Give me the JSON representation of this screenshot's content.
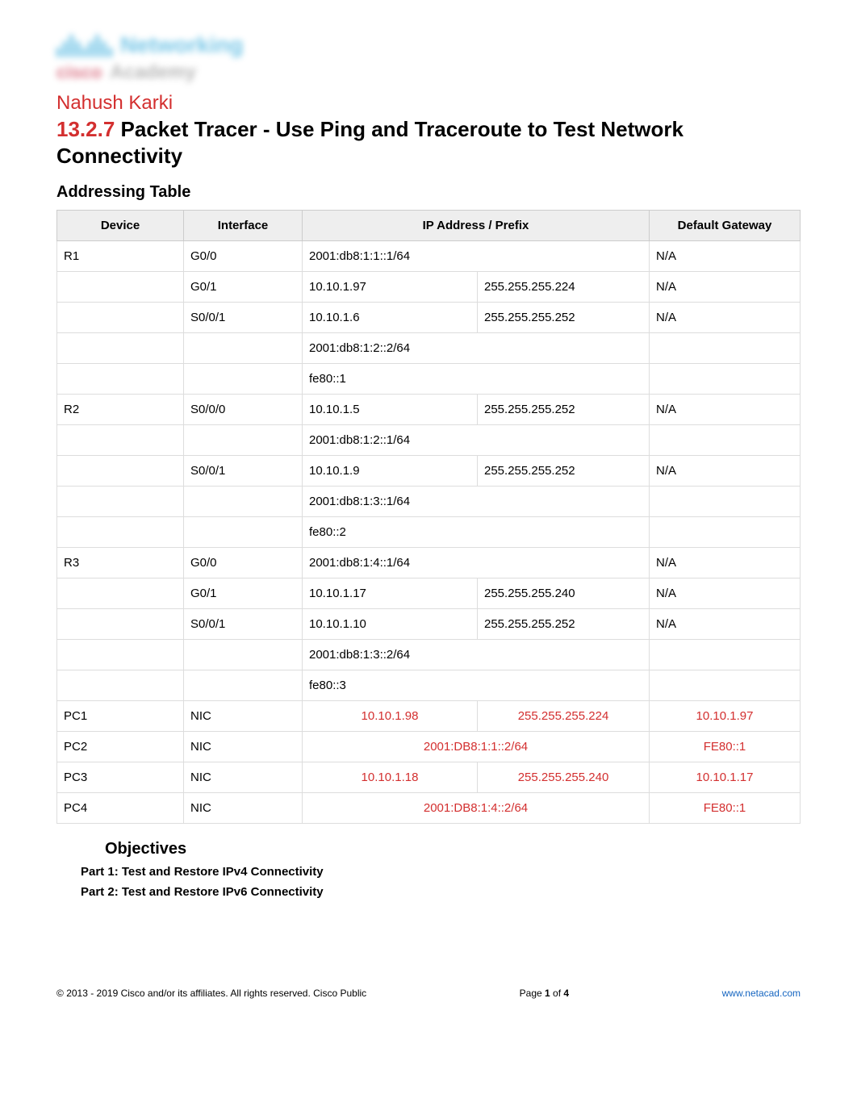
{
  "logo": {
    "line1": "Networking",
    "cisco": "cisco",
    "line2": "Academy"
  },
  "author": "Nahush Karki",
  "title_num": "13.2.7",
  "title_rest": " Packet Tracer - Use Ping and Traceroute to Test Network Connectivity",
  "addressing_heading": "Addressing Table",
  "table": {
    "headers": {
      "device": "Device",
      "interface": "Interface",
      "ipprefix": "IP Address / Prefix",
      "gateway": "Default Gateway"
    },
    "rows": [
      {
        "device": "R1",
        "iface": "G0/0",
        "ip1": "2001:db8:1:1::1/64",
        "ip2": "",
        "gw": "N/A",
        "colspan_ip": true
      },
      {
        "device": "",
        "iface": "G0/1",
        "ip1": "10.10.1.97",
        "ip2": "255.255.255.224",
        "gw": "N/A"
      },
      {
        "device": "",
        "iface": "S0/0/1",
        "ip1": "10.10.1.6",
        "ip2": "255.255.255.252",
        "gw": "N/A"
      },
      {
        "device": "",
        "iface": "",
        "ip1": "2001:db8:1:2::2/64",
        "ip2": "",
        "gw": "",
        "colspan_ip": true
      },
      {
        "device": "",
        "iface": "",
        "ip1": "fe80::1",
        "ip2": "",
        "gw": "",
        "colspan_ip": true
      },
      {
        "device": "R2",
        "iface": "S0/0/0",
        "ip1": "10.10.1.5",
        "ip2": "255.255.255.252",
        "gw": "N/A"
      },
      {
        "device": "",
        "iface": "",
        "ip1": "2001:db8:1:2::1/64",
        "ip2": "",
        "gw": "",
        "colspan_ip": true
      },
      {
        "device": "",
        "iface": "S0/0/1",
        "ip1": "10.10.1.9",
        "ip2": "255.255.255.252",
        "gw": "N/A"
      },
      {
        "device": "",
        "iface": "",
        "ip1": "2001:db8:1:3::1/64",
        "ip2": "",
        "gw": "",
        "colspan_ip": true
      },
      {
        "device": "",
        "iface": "",
        "ip1": "fe80::2",
        "ip2": "",
        "gw": "",
        "colspan_ip": true
      },
      {
        "device": "R3",
        "iface": "G0/0",
        "ip1": "2001:db8:1:4::1/64",
        "ip2": "",
        "gw": "N/A",
        "colspan_ip": true
      },
      {
        "device": "",
        "iface": "G0/1",
        "ip1": "10.10.1.17",
        "ip2": "255.255.255.240",
        "gw": "N/A"
      },
      {
        "device": "",
        "iface": "S0/0/1",
        "ip1": "10.10.1.10",
        "ip2": "255.255.255.252",
        "gw": "N/A"
      },
      {
        "device": "",
        "iface": "",
        "ip1": "2001:db8:1:3::2/64",
        "ip2": "",
        "gw": "",
        "colspan_ip": true
      },
      {
        "device": "",
        "iface": "",
        "ip1": "fe80::3",
        "ip2": "",
        "gw": "",
        "colspan_ip": true
      },
      {
        "device": "PC1",
        "iface": "NIC",
        "ip1": "10.10.1.98",
        "ip2": "255.255.255.224",
        "gw": "10.10.1.97",
        "red": true
      },
      {
        "device": "PC2",
        "iface": "NIC",
        "ip1": "2001:DB8:1:1::2/64",
        "ip2": "",
        "gw": "FE80::1",
        "red": true,
        "colspan_ip": true
      },
      {
        "device": "PC3",
        "iface": "NIC",
        "ip1": "10.10.1.18",
        "ip2": "255.255.255.240",
        "gw": "10.10.1.17",
        "red": true
      },
      {
        "device": "PC4",
        "iface": "NIC",
        "ip1": "2001:DB8:1:4::2/64",
        "ip2": "",
        "gw": "FE80::1",
        "red": true,
        "colspan_ip": true
      }
    ]
  },
  "objectives": {
    "heading": "Objectives",
    "part1": "Part 1: Test and Restore IPv4 Connectivity",
    "part2": "Part 2: Test and Restore IPv6 Connectivity"
  },
  "footer": {
    "copyright": "2013 - 2019 Cisco and/or its affiliates. All rights reserved. Cisco Public",
    "page_prefix": "Page ",
    "page_num": "1",
    "page_of": " of ",
    "page_total": "4",
    "link": "www.netacad.com"
  }
}
